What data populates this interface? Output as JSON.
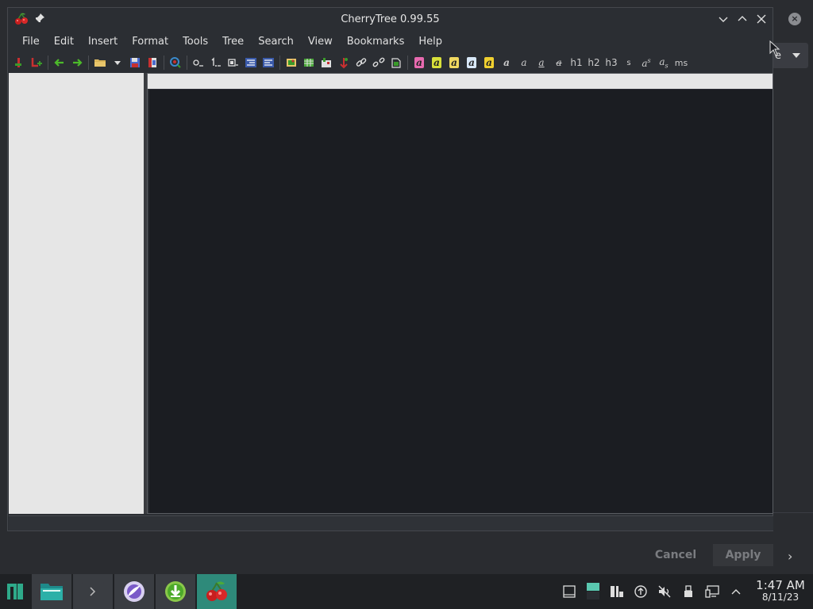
{
  "window": {
    "title": "CherryTree 0.99.55"
  },
  "menubar": {
    "items": [
      "File",
      "Edit",
      "Insert",
      "Format",
      "Tools",
      "Tree",
      "Search",
      "View",
      "Bookmarks",
      "Help"
    ]
  },
  "toolbar": {
    "heading1": "h1",
    "heading2": "h2",
    "heading3": "h3",
    "small": "s",
    "monospace": "ms",
    "fmt_a": "a"
  },
  "background_app": {
    "combo_text": "e",
    "cancel_label": "Cancel",
    "apply_label": "Apply"
  },
  "taskbar": {
    "time": "1:47 AM",
    "date": "8/11/23"
  },
  "colors": {
    "accent": "#2e8a7a",
    "editor_bg": "#1b1d22",
    "tree_bg": "#e6e6e6"
  }
}
